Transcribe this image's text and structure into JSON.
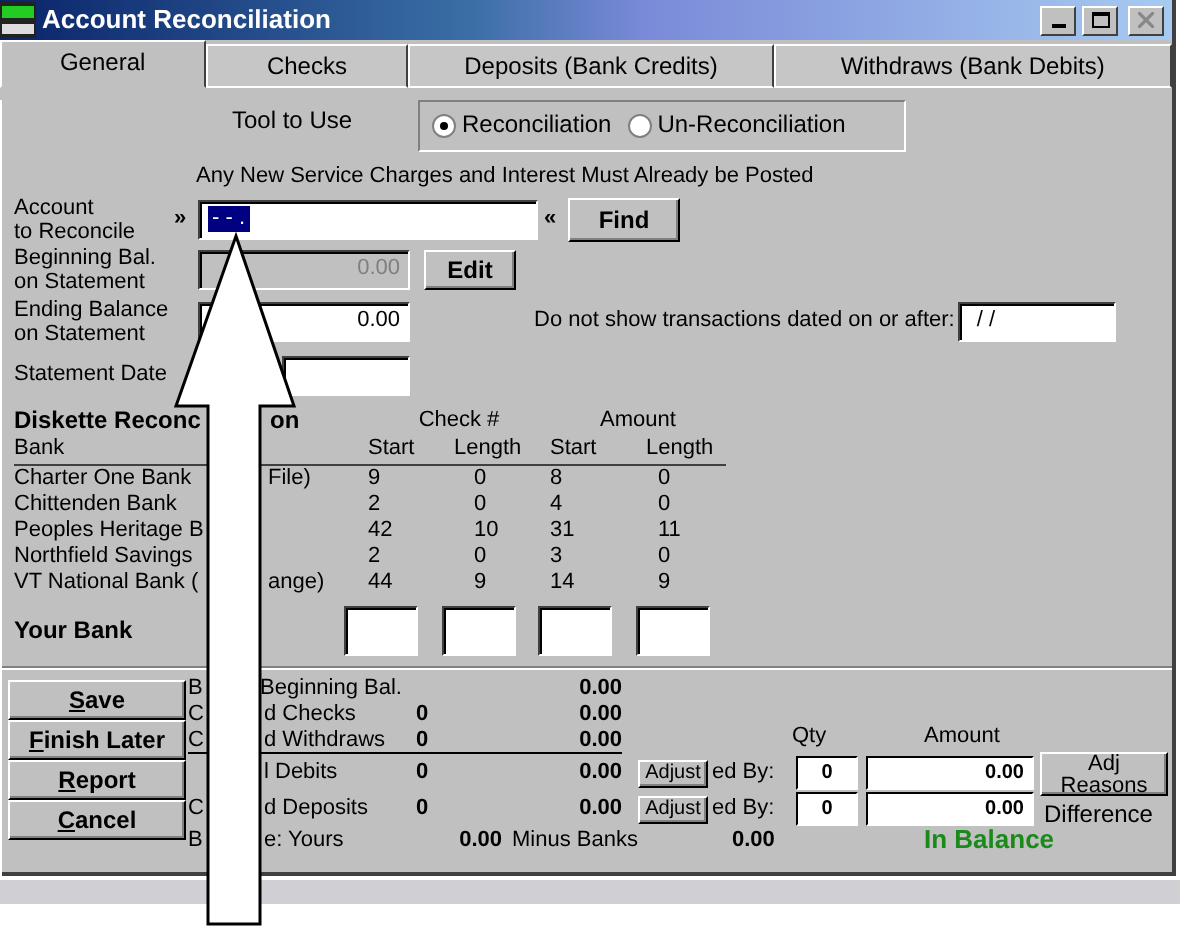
{
  "window": {
    "title": "Account Reconciliation"
  },
  "tabs": [
    {
      "label": "General",
      "selected": true
    },
    {
      "label": "Checks",
      "selected": false
    },
    {
      "label": "Deposits (Bank Credits)",
      "selected": false
    },
    {
      "label": "Withdraws (Bank Debits)",
      "selected": false
    }
  ],
  "tool": {
    "label": "Tool to Use",
    "options": [
      {
        "label": "Reconciliation",
        "selected": true
      },
      {
        "label": "Un-Reconciliation",
        "selected": false
      }
    ]
  },
  "notice": "Any New Service Charges and Interest Must Already be Posted",
  "account": {
    "label_lines": [
      "Account",
      "to Reconcile"
    ],
    "prefix": "»",
    "value": "- - .",
    "suffix": "«",
    "find_button": "Find"
  },
  "beginning_balance": {
    "label_lines": [
      "Beginning Bal.",
      "on Statement"
    ],
    "value": "0.00",
    "disabled": true,
    "edit_button": "Edit"
  },
  "ending_balance": {
    "label_lines": [
      "Ending Balance",
      "on Statement"
    ],
    "value": "0.00"
  },
  "statement_date": {
    "label": "Statement Date"
  },
  "cutoff": {
    "label": "Do not show transactions dated on or after:",
    "value": "/ /"
  },
  "diskette": {
    "title_left": "Diskette Reconc",
    "title_right": "on",
    "group_headers": [
      "Check #",
      "Amount"
    ],
    "bank_header": "Bank",
    "columns": [
      "Start",
      "Length",
      "Start",
      "Length"
    ],
    "rows": [
      {
        "bank_left": "Charter One Bank",
        "bank_right": "File)",
        "cells": [
          "9",
          "0",
          "8",
          "0"
        ]
      },
      {
        "bank_left": "Chittenden Bank",
        "cells": [
          "2",
          "0",
          "4",
          "0"
        ]
      },
      {
        "bank_left": "Peoples Heritage B",
        "cells": [
          "42",
          "10",
          "31",
          "11"
        ]
      },
      {
        "bank_left": "Northfield Savings",
        "cells": [
          "2",
          "0",
          "3",
          "0"
        ]
      },
      {
        "bank_left": "VT National Bank (",
        "bank_right": "ange)",
        "cells": [
          "44",
          "9",
          "14",
          "9"
        ]
      }
    ],
    "your_bank": {
      "label": "Your Bank"
    }
  },
  "buttons": [
    "Save",
    "Finish Later",
    "Report",
    "Cancel"
  ],
  "summary": {
    "qty_header": "Qty",
    "amount_header": "Amount",
    "adj_reasons_button": "Adj Reasons",
    "rows": [
      {
        "label_left": "B",
        "label_right": "Beginning Bal.",
        "amount": "0.00"
      },
      {
        "label_left": "C",
        "label_right": "d Checks",
        "qty": "0",
        "amount": "0.00"
      },
      {
        "label_left": "C",
        "label_right": "d Withdraws",
        "qty": "0",
        "amount": "0.00"
      },
      {
        "label_right": "l Debits",
        "qty": "0",
        "amount": "0.00",
        "adjust": {
          "button": "Adjust",
          "label": "ed By:",
          "qty": "0",
          "amount": "0.00"
        }
      },
      {
        "label_left": "C",
        "label_right": "d Deposits",
        "qty": "0",
        "amount": "0.00",
        "adjust": {
          "button": "Adjust",
          "label": "ed By:",
          "qty": "0",
          "amount": "0.00"
        }
      }
    ],
    "balance": {
      "label_left": "B",
      "label_right": "e: Yours",
      "yours": "0.00",
      "minus_label": "Minus Banks",
      "minus_value": "0.00"
    },
    "difference": {
      "label": "Difference",
      "status": "In Balance"
    }
  }
}
